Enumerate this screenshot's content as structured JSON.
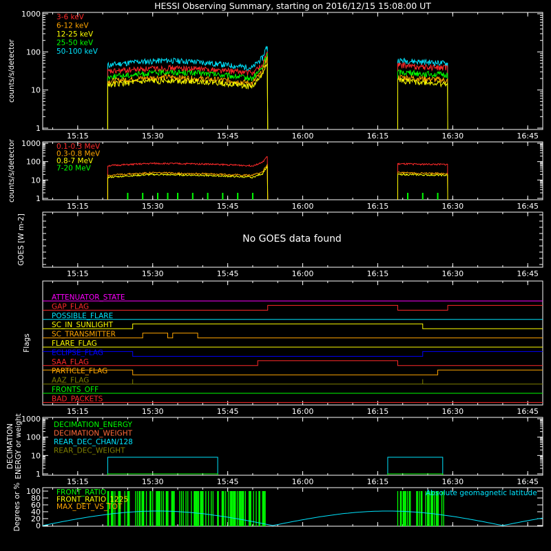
{
  "title": "HESSI Observing Summary, starting on 2016/12/15 15:08:00 UT",
  "time_ticks": [
    "15:15",
    "15:30",
    "15:45",
    "16:00",
    "16:15",
    "16:30",
    "16:45"
  ],
  "chart_data": [
    {
      "type": "line",
      "panel": "lo-energy",
      "ylabel": "counts/s/detector",
      "yscale": "log",
      "ylim": [
        1,
        1000
      ],
      "yticks": [
        "1",
        "10",
        "100",
        "1000"
      ],
      "xlim": [
        "15:08",
        "16:48"
      ],
      "legend_placement": "top-left",
      "observing_intervals": [
        [
          "15:21",
          "15:53"
        ],
        [
          "16:19",
          "16:29"
        ]
      ],
      "series": [
        {
          "name": "3-6 keV",
          "color": "#ff2a2a",
          "t": [
            "15:21",
            "15:27",
            "15:33",
            "15:39",
            "15:45",
            "15:50",
            "15:52",
            "15:53",
            "16:19",
            "16:24",
            "16:29"
          ],
          "values": [
            30,
            35,
            38,
            36,
            32,
            28,
            45,
            100,
            45,
            40,
            38
          ]
        },
        {
          "name": "6-12 keV",
          "color": "#ffa500",
          "t": [
            "15:21",
            "15:27",
            "15:33",
            "15:39",
            "15:45",
            "15:50",
            "15:52",
            "15:53",
            "16:19",
            "16:24",
            "16:29"
          ],
          "values": [
            17,
            20,
            22,
            20,
            18,
            15,
            30,
            70,
            22,
            20,
            18
          ]
        },
        {
          "name": "12-25 keV",
          "color": "#ffff00",
          "t": [
            "15:21",
            "15:27",
            "15:33",
            "15:39",
            "15:45",
            "15:50",
            "15:52",
            "15:53",
            "16:19",
            "16:24",
            "16:29"
          ],
          "values": [
            14,
            16,
            18,
            17,
            15,
            12,
            25,
            60,
            18,
            16,
            14
          ]
        },
        {
          "name": "25-50 keV",
          "color": "#00ff00",
          "t": [
            "15:21",
            "15:27",
            "15:33",
            "15:39",
            "15:45",
            "15:50",
            "15:52",
            "15:53",
            "16:19",
            "16:24",
            "16:29"
          ],
          "values": [
            22,
            26,
            30,
            28,
            24,
            20,
            38,
            90,
            30,
            27,
            25
          ]
        },
        {
          "name": "50-100 keV",
          "color": "#00e5ff",
          "t": [
            "15:21",
            "15:27",
            "15:33",
            "15:39",
            "15:45",
            "15:50",
            "15:52",
            "15:53",
            "16:19",
            "16:24",
            "16:29"
          ],
          "values": [
            45,
            55,
            60,
            55,
            45,
            38,
            70,
            150,
            60,
            55,
            50
          ]
        }
      ]
    },
    {
      "type": "line",
      "panel": "hi-energy",
      "ylabel": "counts/s/detector",
      "yscale": "log",
      "ylim": [
        1,
        1000
      ],
      "yticks": [
        "1",
        "10",
        "100",
        "1000"
      ],
      "xlim": [
        "15:08",
        "16:48"
      ],
      "legend_placement": "top-left",
      "observing_intervals": [
        [
          "15:21",
          "15:53"
        ],
        [
          "16:19",
          "16:29"
        ]
      ],
      "series": [
        {
          "name": "0.1-0.3 MeV",
          "color": "#ff2a2a",
          "t": [
            "15:21",
            "15:30",
            "15:40",
            "15:50",
            "15:52",
            "15:53",
            "16:19",
            "16:29"
          ],
          "values": [
            60,
            80,
            75,
            60,
            90,
            200,
            75,
            70
          ]
        },
        {
          "name": "0.3-0.8 MeV",
          "color": "#ffa500",
          "t": [
            "15:21",
            "15:30",
            "15:40",
            "15:50",
            "15:52",
            "15:53",
            "16:19",
            "16:29"
          ],
          "values": [
            18,
            25,
            22,
            18,
            28,
            70,
            25,
            22
          ]
        },
        {
          "name": "0.8-7 MeV",
          "color": "#ffff00",
          "t": [
            "15:21",
            "15:30",
            "15:40",
            "15:50",
            "15:52",
            "15:53",
            "16:19",
            "16:29"
          ],
          "values": [
            14,
            20,
            18,
            14,
            22,
            55,
            20,
            18
          ]
        },
        {
          "name": "7-20 MeV",
          "color": "#00ff00",
          "type": "spikes",
          "t": [
            "15:25",
            "15:28",
            "15:31",
            "15:33",
            "15:35",
            "15:38",
            "15:41",
            "15:44",
            "15:47",
            "15:50",
            "16:21",
            "16:24",
            "16:27"
          ],
          "values": [
            2,
            2,
            2,
            2,
            2,
            2,
            2,
            2,
            2,
            2,
            2,
            2,
            2
          ]
        }
      ]
    },
    {
      "type": "line",
      "panel": "goes",
      "ylabel": "GOES [W m-2]",
      "message": "No GOES data found"
    },
    {
      "type": "line",
      "panel": "flags",
      "ylabel": "Flags",
      "series": [
        {
          "name": "ATTENUATOR_STATE",
          "color": "#ff00ff",
          "segments": [
            [
              "15:08",
              "16:48",
              0
            ]
          ]
        },
        {
          "name": "GAP_FLAG",
          "color": "#ff2a2a",
          "segments": [
            [
              "15:08",
              "15:53",
              0
            ],
            [
              "15:53",
              "16:19",
              1
            ],
            [
              "16:19",
              "16:29",
              0
            ],
            [
              "16:29",
              "16:48",
              1
            ]
          ]
        },
        {
          "name": "POSSIBLE_FLARE",
          "color": "#00e5ff",
          "segments": [
            [
              "15:08",
              "16:48",
              0
            ]
          ]
        },
        {
          "name": "SC_IN_SUNLIGHT",
          "color": "#ffff00",
          "segments": [
            [
              "15:08",
              "15:26",
              0
            ],
            [
              "15:26",
              "16:24",
              1
            ],
            [
              "16:24",
              "16:48",
              0
            ]
          ]
        },
        {
          "name": "SC_TRANSMITTER",
          "color": "#ffa500",
          "segments": [
            [
              "15:08",
              "15:28",
              0
            ],
            [
              "15:28",
              "15:33",
              1
            ],
            [
              "15:33",
              "15:34",
              0
            ],
            [
              "15:34",
              "15:39",
              1
            ],
            [
              "15:39",
              "16:48",
              0
            ]
          ]
        },
        {
          "name": "FLARE_FLAG",
          "color": "#ffff00",
          "segments": [
            [
              "15:08",
              "16:48",
              0
            ]
          ]
        },
        {
          "name": "ECLIPSE_FLAG",
          "color": "#0000ff",
          "segments": [
            [
              "15:08",
              "15:26",
              1
            ],
            [
              "15:26",
              "16:24",
              0
            ],
            [
              "16:24",
              "16:48",
              1
            ]
          ]
        },
        {
          "name": "SAA_FLAG",
          "color": "#ff2a2a",
          "segments": [
            [
              "15:08",
              "15:51",
              0
            ],
            [
              "15:51",
              "16:19",
              1
            ],
            [
              "16:19",
              "16:48",
              0
            ]
          ]
        },
        {
          "name": "PARTICLE_FLAG",
          "color": "#ffa500",
          "segments": [
            [
              "15:08",
              "15:26",
              1
            ],
            [
              "15:26",
              "16:27",
              0
            ],
            [
              "16:27",
              "16:48",
              1
            ]
          ]
        },
        {
          "name": "AAZ_FLAG",
          "color": "#808000",
          "segments": [
            [
              "15:08",
              "15:26",
              0
            ],
            [
              "15:26",
              "15:26",
              1
            ],
            [
              "15:26",
              "16:24",
              0
            ],
            [
              "16:24",
              "16:24",
              1
            ],
            [
              "16:24",
              "16:48",
              0
            ]
          ]
        },
        {
          "name": "FRONTS_OFF",
          "color": "#00ff00",
          "segments": [
            [
              "15:08",
              "16:48",
              0
            ]
          ]
        },
        {
          "name": "BAD_PACKETS",
          "color": "#ff2a2a",
          "segments": [
            [
              "15:08",
              "16:48",
              0
            ]
          ]
        }
      ]
    },
    {
      "type": "line",
      "panel": "decimation",
      "ylabel": "DECIMATION ENERGY or weight",
      "yscale": "log",
      "ylim": [
        1,
        1000
      ],
      "yticks": [
        "1",
        "10",
        "100",
        "1000"
      ],
      "series": [
        {
          "name": "DECIMATION_ENERGY",
          "color": "#00ff00",
          "segments": [
            [
              "15:21",
              "15:43",
              1
            ],
            [
              "16:17",
              "16:28",
              1
            ]
          ]
        },
        {
          "name": "DECIMATION_WEIGHT",
          "color": "#ff6a3a",
          "segments": [
            [
              "15:21",
              "15:43",
              1
            ],
            [
              "16:17",
              "16:28",
              1
            ]
          ]
        },
        {
          "name": "REAR_DEC_CHAN/128",
          "color": "#00e5ff",
          "segments": [
            [
              "15:21",
              "15:43",
              8
            ],
            [
              "16:17",
              "16:28",
              8
            ]
          ]
        },
        {
          "name": "REAR_DEC_WEIGHT",
          "color": "#808000",
          "segments": [
            [
              "15:21",
              "15:43",
              1
            ],
            [
              "16:17",
              "16:28",
              1
            ]
          ]
        }
      ]
    },
    {
      "type": "line",
      "panel": "ratios",
      "ylabel": "Degrees or %",
      "ylim": [
        0,
        100
      ],
      "yticks": [
        "0",
        "20",
        "40",
        "60",
        "80",
        "100"
      ],
      "annotation": "Absolute geomagnetic latitude",
      "series": [
        {
          "name": "FRONT_RATIO",
          "color": "#00ff00",
          "type": "spikes",
          "intervals": [
            [
              "15:21",
              "15:53"
            ],
            [
              "16:19",
              "16:29"
            ]
          ],
          "value": 100
        },
        {
          "name": "FRONT_RATIO_1225",
          "color": "#ffff00",
          "type": "spikes",
          "intervals": [
            [
              "15:21",
              "15:53"
            ],
            [
              "16:19",
              "16:29"
            ]
          ],
          "value": 100
        },
        {
          "name": "MAX_DET_VS_TOT",
          "color": "#ffa500",
          "type": "spikes",
          "intervals": [
            [
              "15:21",
              "15:53"
            ],
            [
              "16:19",
              "16:29"
            ]
          ],
          "value": 100
        },
        {
          "name": "Absolute geomagnetic latitude",
          "color": "#00e5ff",
          "t": [
            "15:08",
            "15:31",
            "15:54",
            "16:17",
            "16:40",
            "16:48"
          ],
          "values": [
            0,
            42,
            0,
            42,
            0,
            12
          ]
        }
      ]
    }
  ]
}
